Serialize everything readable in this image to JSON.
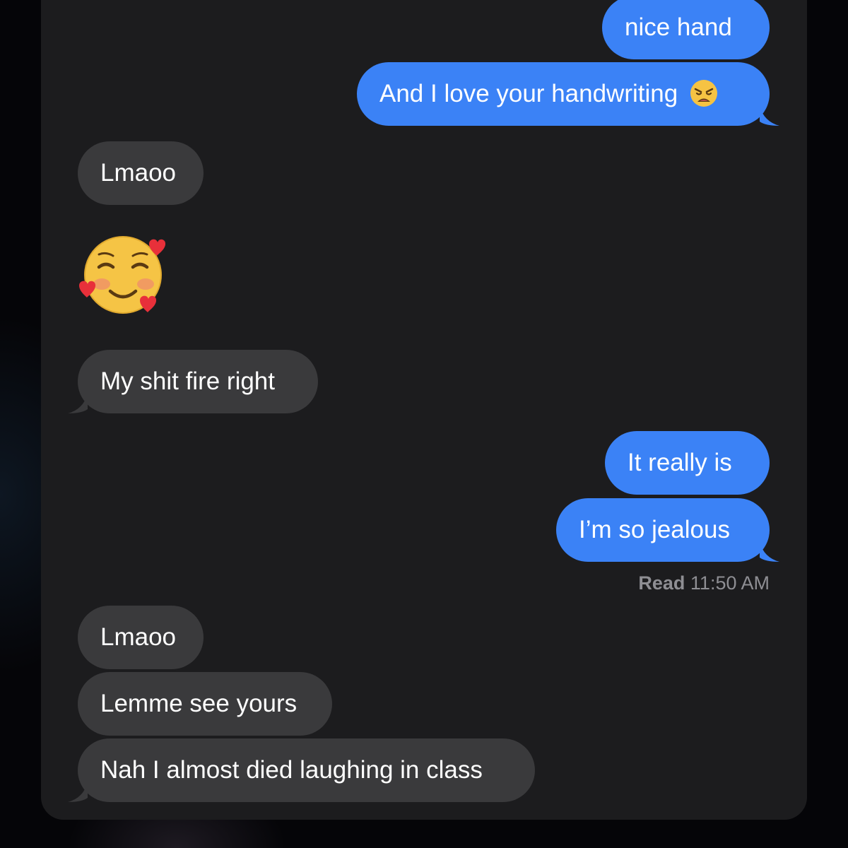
{
  "messages": [
    {
      "side": "sent",
      "text": "nice hand"
    },
    {
      "side": "sent",
      "text": "And I love your handwriting",
      "emoji": "weary-face-emoji"
    },
    {
      "side": "received",
      "text": "Lmaoo"
    },
    {
      "side": "received",
      "emoji": "smiling-face-with-hearts-emoji"
    },
    {
      "side": "received",
      "text": "My shit fire right"
    },
    {
      "side": "sent",
      "text": "It really is"
    },
    {
      "side": "sent",
      "text": "I’m so jealous"
    },
    {
      "side": "received",
      "text": "Lmaoo"
    },
    {
      "side": "received",
      "text": "Lemme see yours"
    },
    {
      "side": "received",
      "text": "Nah I almost died laughing in class"
    }
  ],
  "read_receipt": {
    "label": "Read",
    "time": "11:50 AM"
  },
  "colors": {
    "sent_bubble": "#3b82f6",
    "received_bubble": "#3a3a3c",
    "background": "#1c1c1e",
    "receipt_text": "#8e8e93"
  }
}
